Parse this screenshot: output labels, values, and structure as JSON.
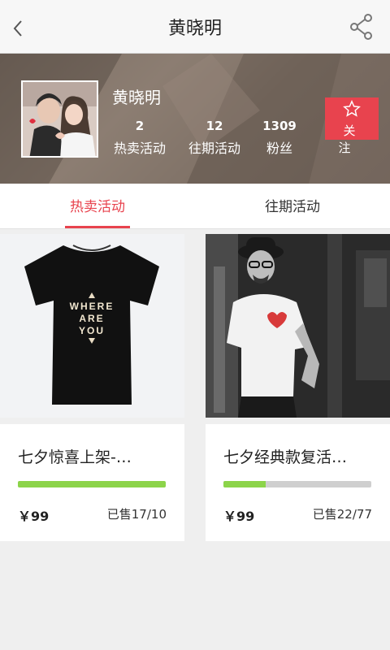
{
  "header": {
    "title": "黄晓明",
    "back_icon": "chevron-left-icon",
    "share_icon": "share-icon"
  },
  "profile": {
    "name": "黄晓明",
    "stats": [
      {
        "value": "2",
        "label": "热卖活动"
      },
      {
        "value": "12",
        "label": "往期活动"
      },
      {
        "value": "1309",
        "label": "粉丝"
      }
    ],
    "follow_label": "关注",
    "follow_icon": "star-outline-icon"
  },
  "tabs": [
    {
      "label": "热卖活动",
      "active": true
    },
    {
      "label": "往期活动",
      "active": false
    }
  ],
  "products": [
    {
      "title": "七夕惊喜上架-…",
      "price": "￥99",
      "sold": "已售17/10",
      "progress": 1.0,
      "shirt_text": [
        "WHERE",
        "ARE",
        "YOU"
      ]
    },
    {
      "title": "七夕经典款复活…",
      "price": "￥99",
      "sold": "已售22/77",
      "progress": 0.286
    }
  ],
  "colors": {
    "accent": "#e8434e",
    "progress": "#8cd44a",
    "progress_track": "#cfcfcf"
  }
}
